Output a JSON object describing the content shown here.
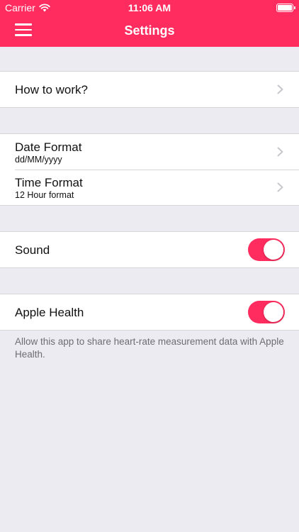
{
  "status_bar": {
    "carrier": "Carrier",
    "time": "11:06 AM"
  },
  "header": {
    "title": "Settings",
    "menu_icon": "hamburger-menu-icon"
  },
  "groups": {
    "help": {
      "how_to_work": "How to work?"
    },
    "formats": {
      "date_label": "Date Format",
      "date_value": "dd/MM/yyyy",
      "time_label": "Time Format",
      "time_value": "12 Hour format"
    },
    "sound": {
      "label": "Sound",
      "enabled": true
    },
    "health": {
      "label": "Apple Health",
      "enabled": true,
      "footnote": "Allow this app to share heart-rate measurement data with Apple Health."
    }
  },
  "colors": {
    "accent": "#FF2D5F",
    "background": "#EBEBF1",
    "footnote_text": "#6D6D72"
  }
}
